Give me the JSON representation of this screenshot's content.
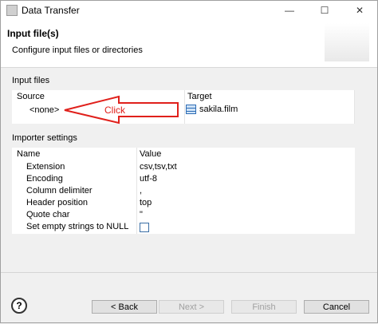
{
  "window": {
    "title": "Data Transfer"
  },
  "header": {
    "title": "Input file(s)",
    "description": "Configure input files or directories"
  },
  "input_files": {
    "label": "Input files",
    "columns": [
      "Source",
      "Target"
    ],
    "source": "<none>",
    "target": "sakila.film"
  },
  "annotation": {
    "text": "Click",
    "color": "#e0201b"
  },
  "importer_settings": {
    "label": "Importer settings",
    "columns": [
      "Name",
      "Value"
    ],
    "rows": [
      {
        "name": "Extension",
        "value": "csv,tsv,txt"
      },
      {
        "name": "Encoding",
        "value": "utf-8"
      },
      {
        "name": "Column delimiter",
        "value": ","
      },
      {
        "name": "Header position",
        "value": "top"
      },
      {
        "name": "Quote char",
        "value": "\""
      },
      {
        "name": "Set empty strings to NULL",
        "value": ""
      }
    ]
  },
  "buttons": {
    "back": "< Back",
    "next": "Next >",
    "finish": "Finish",
    "cancel": "Cancel"
  },
  "icons": {
    "help": "?",
    "minimize": "—",
    "maximize": "☐",
    "close": "✕"
  }
}
